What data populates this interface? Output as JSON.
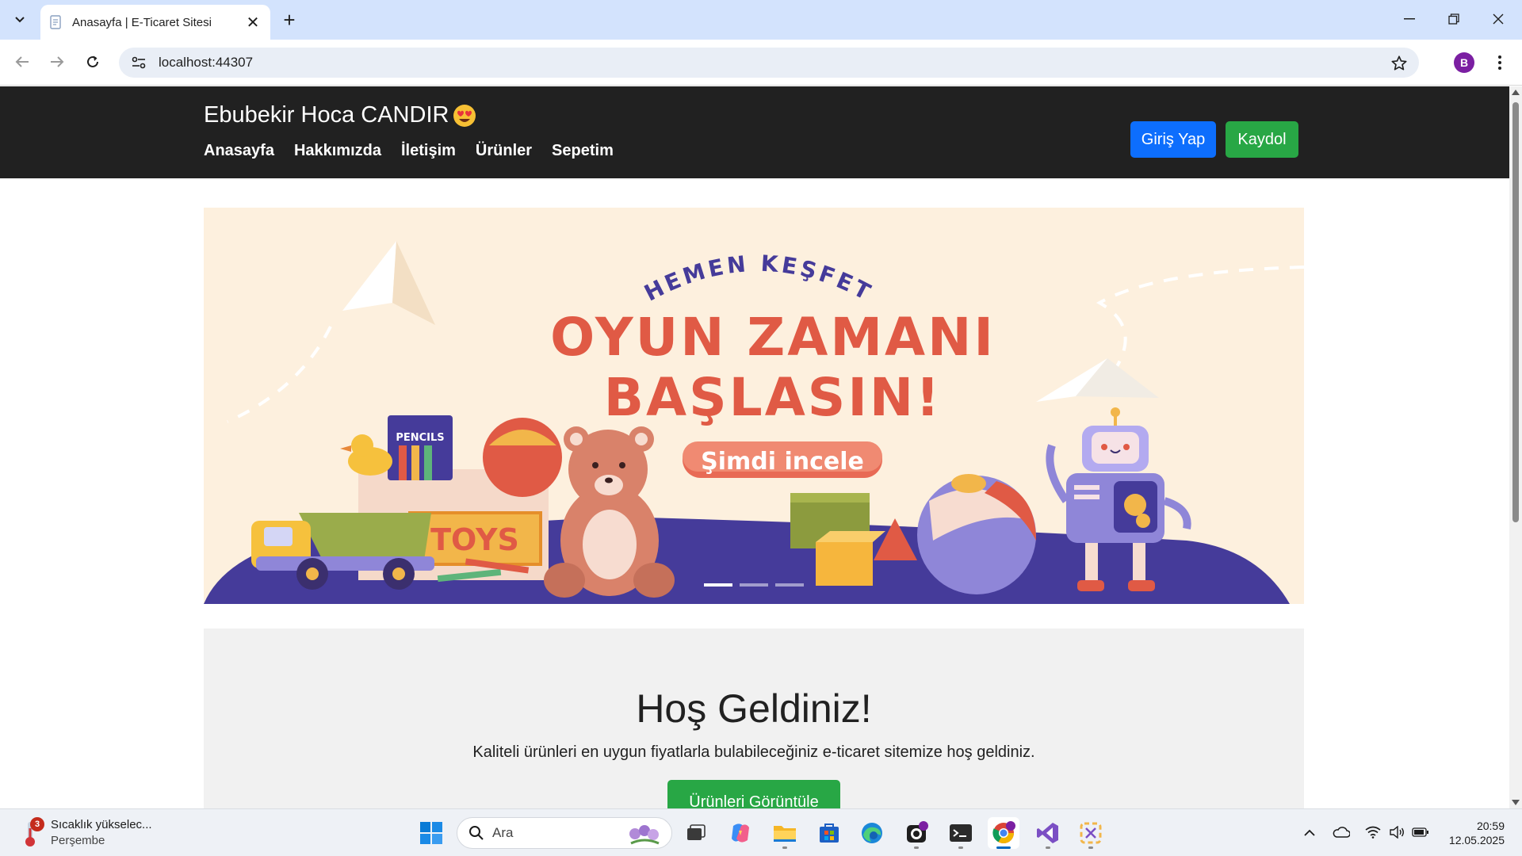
{
  "browser": {
    "tab_title": "Anasayfa | E-Ticaret Sitesi",
    "url": "localhost:44307",
    "profile_initial": "B"
  },
  "site": {
    "brand": "Ebubekir Hoca CANDIR",
    "nav": [
      "Anasayfa",
      "Hakkımızda",
      "İletişim",
      "Ürünler",
      "Sepetim"
    ],
    "login_label": "Giriş Yap",
    "register_label": "Kaydol"
  },
  "banner": {
    "kicker": "HEMEN KEŞFET",
    "headline_line1": "OYUN ZAMANI",
    "headline_line2": "BAŞLASIN!",
    "cta": "Şimdi incele",
    "box_label": "TOYS",
    "pencils_label": "PENCILS",
    "active_slide": 1,
    "slide_count": 3
  },
  "welcome": {
    "title": "Hoş Geldiniz!",
    "text": "Kaliteli ürünleri en uygun fiyatlarla bulabileceğiniz e-ticaret sitemize hoş geldiniz.",
    "button": "Ürünleri Görüntüle"
  },
  "taskbar": {
    "weather_badge": "3",
    "weather_line1": "Sıcaklık yükselec...",
    "weather_line2": "Perşembe",
    "search_placeholder": "Ara",
    "time": "20:59",
    "date": "12.05.2025"
  },
  "colors": {
    "nav_bg": "#212121",
    "primary": "#0d6efd",
    "success": "#28a745",
    "banner_bg": "#fdf0de",
    "banner_purple": "#453b9a",
    "banner_red": "#e05a45"
  }
}
